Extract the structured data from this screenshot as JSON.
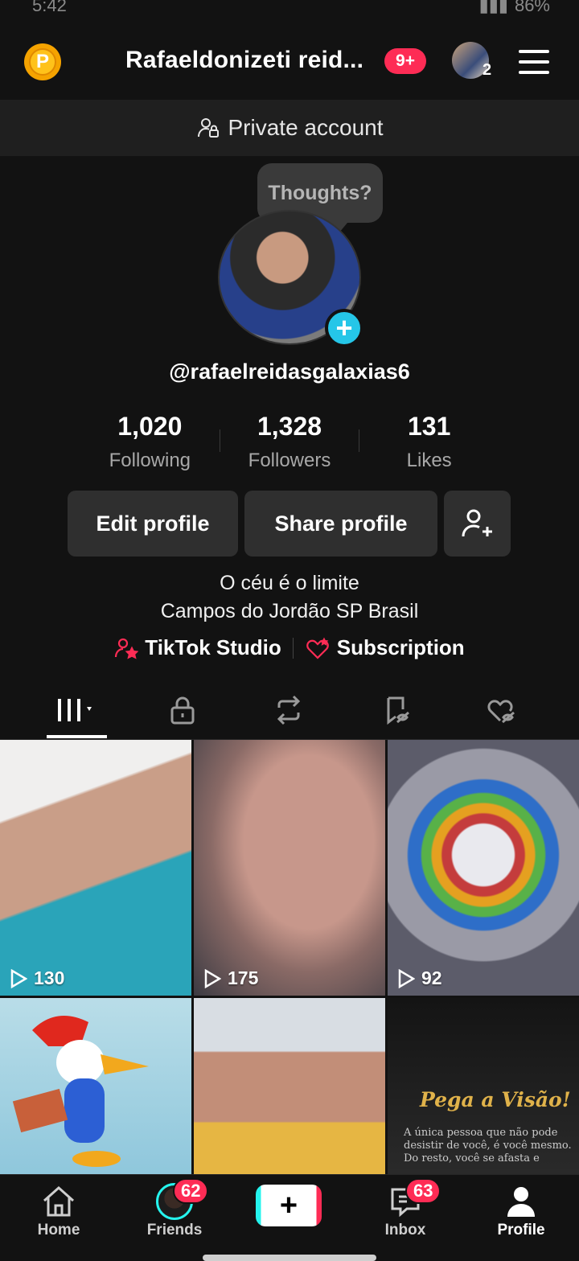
{
  "status_bar": {
    "time": "5:42",
    "battery": "86%"
  },
  "header": {
    "title": "Rafaeldonizeti reid...",
    "notification_badge": "9+",
    "account_count": "2"
  },
  "private_banner": {
    "label": "Private account"
  },
  "avatar_bubble": {
    "text": "Thoughts?"
  },
  "profile": {
    "handle": "@rafaelreidasgalaxias6",
    "stats": [
      {
        "value": "1,020",
        "label": "Following"
      },
      {
        "value": "1,328",
        "label": "Followers"
      },
      {
        "value": "131",
        "label": "Likes"
      }
    ],
    "buttons": {
      "edit": "Edit profile",
      "share": "Share profile"
    },
    "bio": [
      "O céu é o limite",
      "Campos do Jordão SP Brasil"
    ],
    "links": {
      "studio": "TikTok Studio",
      "subscription": "Subscription"
    }
  },
  "videos": [
    {
      "views": "130"
    },
    {
      "views": "175"
    },
    {
      "views": "92"
    },
    {
      "views": ""
    },
    {
      "views": ""
    },
    {
      "views": "",
      "caption_title": "Pega a Visão!",
      "caption_lines": [
        "A única pessoa que não pode",
        "desistir de você, é você mesmo.",
        "Do resto, você se afasta e"
      ]
    }
  ],
  "bottom_nav": {
    "home": "Home",
    "friends": "Friends",
    "friends_badge": "62",
    "inbox": "Inbox",
    "inbox_badge": "63",
    "profile": "Profile"
  },
  "colors": {
    "accent": "#fe2c55",
    "cyan": "#25c6e8",
    "background": "#121212"
  }
}
